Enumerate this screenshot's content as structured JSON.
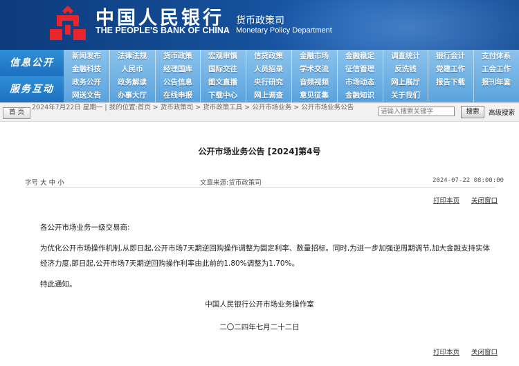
{
  "header": {
    "cn_title": "中国人民银行",
    "en_title": "THE PEOPLE'S BANK OF CHINA",
    "dept_cn": "货币政策司",
    "dept_en": "Monetary Policy Department"
  },
  "nav": {
    "band1": "信息公开",
    "band2": "服务互动",
    "rows": [
      [
        "新闻发布",
        "法律法规",
        "货币政策",
        "宏观审慎",
        "信贷政策",
        "金融市场",
        "金融稳定",
        "调查统计",
        "银行会计",
        "支付体系"
      ],
      [
        "金融科技",
        "人民币",
        "经理国库",
        "国际交往",
        "人员招录",
        "学术交流",
        "征信管理",
        "反洗钱",
        "党建工作",
        "工会工作"
      ],
      [
        "政务公开",
        "政务解读",
        "公告信息",
        "图文直播",
        "央行研究",
        "音频视频",
        "市场动态",
        "网上展厅",
        "报告下载",
        "报刊年鉴"
      ],
      [
        "网送文告",
        "办事大厅",
        "在线申报",
        "下载中心",
        "网上调查",
        "意见征集",
        "金融知识",
        "关于我们",
        "",
        ""
      ]
    ]
  },
  "crumb": {
    "home": "首 页",
    "text": "2024年7月22日 星期一 | 我的位置:首页 > 货币政策司 > 货币政策工具 > 公开市场业务 > 公开市场业务公告",
    "search_placeholder": "请输入搜索关键字",
    "search_btn": "搜索",
    "advanced": "高级搜索"
  },
  "article": {
    "title": "公开市场业务公告 [2024]第4号",
    "font_label": "字号",
    "font_sizes": [
      "大",
      "中",
      "小"
    ],
    "source": "文章来源:货币政策司",
    "date": "2024-07-22 08:00:00",
    "print": "打印本页",
    "close": "关闭窗口",
    "salutation": "各公开市场业务一级交易商:",
    "para1": "为优化公开市场操作机制,从即日起,公开市场7天期逆回购操作调整为固定利率、数量招标。同时,为进一步加强逆周期调节,加大金融支持实体经济力度,即日起,公开市场7天期逆回购操作利率由此前的1.80%调整为1.70%。",
    "para2": "特此通知。",
    "signature": "中国人民银行公开市场业务操作室",
    "sign_date": "二〇二四年七月二十二日"
  }
}
